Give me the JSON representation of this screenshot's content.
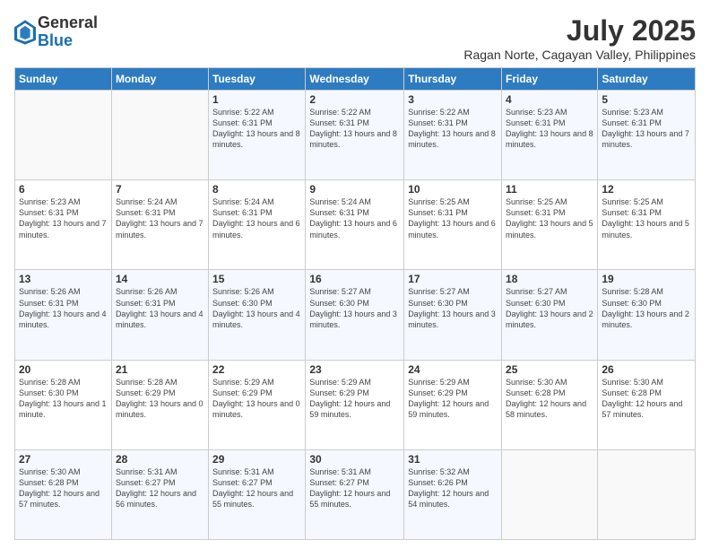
{
  "logo": {
    "general": "General",
    "blue": "Blue"
  },
  "title": "July 2025",
  "subtitle": "Ragan Norte, Cagayan Valley, Philippines",
  "days": [
    "Sunday",
    "Monday",
    "Tuesday",
    "Wednesday",
    "Thursday",
    "Friday",
    "Saturday"
  ],
  "weeks": [
    [
      {
        "day": "",
        "content": ""
      },
      {
        "day": "",
        "content": ""
      },
      {
        "day": "1",
        "content": "Sunrise: 5:22 AM\nSunset: 6:31 PM\nDaylight: 13 hours and 8 minutes."
      },
      {
        "day": "2",
        "content": "Sunrise: 5:22 AM\nSunset: 6:31 PM\nDaylight: 13 hours and 8 minutes."
      },
      {
        "day": "3",
        "content": "Sunrise: 5:22 AM\nSunset: 6:31 PM\nDaylight: 13 hours and 8 minutes."
      },
      {
        "day": "4",
        "content": "Sunrise: 5:23 AM\nSunset: 6:31 PM\nDaylight: 13 hours and 8 minutes."
      },
      {
        "day": "5",
        "content": "Sunrise: 5:23 AM\nSunset: 6:31 PM\nDaylight: 13 hours and 7 minutes."
      }
    ],
    [
      {
        "day": "6",
        "content": "Sunrise: 5:23 AM\nSunset: 6:31 PM\nDaylight: 13 hours and 7 minutes."
      },
      {
        "day": "7",
        "content": "Sunrise: 5:24 AM\nSunset: 6:31 PM\nDaylight: 13 hours and 7 minutes."
      },
      {
        "day": "8",
        "content": "Sunrise: 5:24 AM\nSunset: 6:31 PM\nDaylight: 13 hours and 6 minutes."
      },
      {
        "day": "9",
        "content": "Sunrise: 5:24 AM\nSunset: 6:31 PM\nDaylight: 13 hours and 6 minutes."
      },
      {
        "day": "10",
        "content": "Sunrise: 5:25 AM\nSunset: 6:31 PM\nDaylight: 13 hours and 6 minutes."
      },
      {
        "day": "11",
        "content": "Sunrise: 5:25 AM\nSunset: 6:31 PM\nDaylight: 13 hours and 5 minutes."
      },
      {
        "day": "12",
        "content": "Sunrise: 5:25 AM\nSunset: 6:31 PM\nDaylight: 13 hours and 5 minutes."
      }
    ],
    [
      {
        "day": "13",
        "content": "Sunrise: 5:26 AM\nSunset: 6:31 PM\nDaylight: 13 hours and 4 minutes."
      },
      {
        "day": "14",
        "content": "Sunrise: 5:26 AM\nSunset: 6:31 PM\nDaylight: 13 hours and 4 minutes."
      },
      {
        "day": "15",
        "content": "Sunrise: 5:26 AM\nSunset: 6:30 PM\nDaylight: 13 hours and 4 minutes."
      },
      {
        "day": "16",
        "content": "Sunrise: 5:27 AM\nSunset: 6:30 PM\nDaylight: 13 hours and 3 minutes."
      },
      {
        "day": "17",
        "content": "Sunrise: 5:27 AM\nSunset: 6:30 PM\nDaylight: 13 hours and 3 minutes."
      },
      {
        "day": "18",
        "content": "Sunrise: 5:27 AM\nSunset: 6:30 PM\nDaylight: 13 hours and 2 minutes."
      },
      {
        "day": "19",
        "content": "Sunrise: 5:28 AM\nSunset: 6:30 PM\nDaylight: 13 hours and 2 minutes."
      }
    ],
    [
      {
        "day": "20",
        "content": "Sunrise: 5:28 AM\nSunset: 6:30 PM\nDaylight: 13 hours and 1 minute."
      },
      {
        "day": "21",
        "content": "Sunrise: 5:28 AM\nSunset: 6:29 PM\nDaylight: 13 hours and 0 minutes."
      },
      {
        "day": "22",
        "content": "Sunrise: 5:29 AM\nSunset: 6:29 PM\nDaylight: 13 hours and 0 minutes."
      },
      {
        "day": "23",
        "content": "Sunrise: 5:29 AM\nSunset: 6:29 PM\nDaylight: 12 hours and 59 minutes."
      },
      {
        "day": "24",
        "content": "Sunrise: 5:29 AM\nSunset: 6:29 PM\nDaylight: 12 hours and 59 minutes."
      },
      {
        "day": "25",
        "content": "Sunrise: 5:30 AM\nSunset: 6:28 PM\nDaylight: 12 hours and 58 minutes."
      },
      {
        "day": "26",
        "content": "Sunrise: 5:30 AM\nSunset: 6:28 PM\nDaylight: 12 hours and 57 minutes."
      }
    ],
    [
      {
        "day": "27",
        "content": "Sunrise: 5:30 AM\nSunset: 6:28 PM\nDaylight: 12 hours and 57 minutes."
      },
      {
        "day": "28",
        "content": "Sunrise: 5:31 AM\nSunset: 6:27 PM\nDaylight: 12 hours and 56 minutes."
      },
      {
        "day": "29",
        "content": "Sunrise: 5:31 AM\nSunset: 6:27 PM\nDaylight: 12 hours and 55 minutes."
      },
      {
        "day": "30",
        "content": "Sunrise: 5:31 AM\nSunset: 6:27 PM\nDaylight: 12 hours and 55 minutes."
      },
      {
        "day": "31",
        "content": "Sunrise: 5:32 AM\nSunset: 6:26 PM\nDaylight: 12 hours and 54 minutes."
      },
      {
        "day": "",
        "content": ""
      },
      {
        "day": "",
        "content": ""
      }
    ]
  ]
}
